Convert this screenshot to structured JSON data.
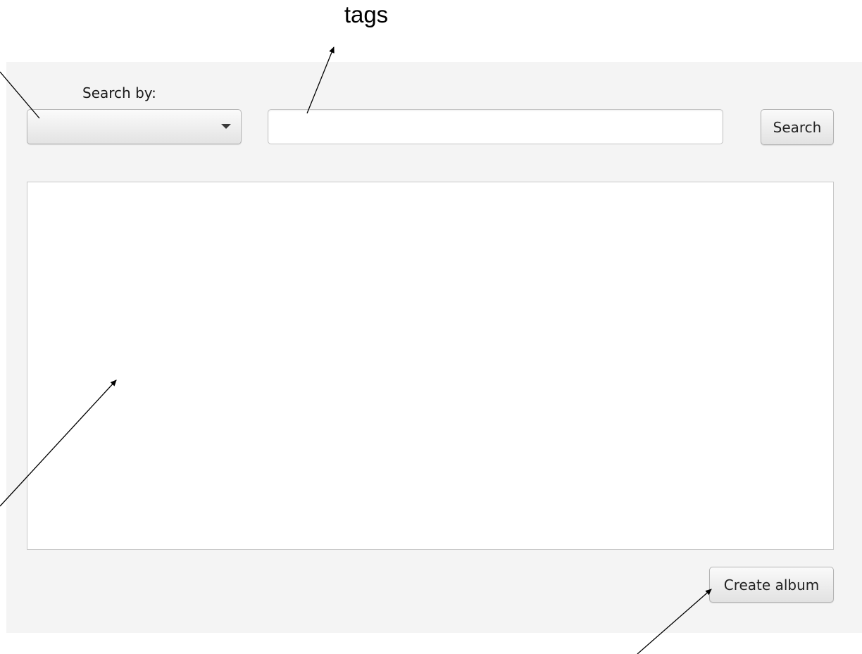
{
  "annotation": {
    "tags_label": "tags"
  },
  "search_panel": {
    "search_by_label": "Search by:",
    "search_by_selected": "",
    "search_input_value": "",
    "search_button_label": "Search"
  },
  "results": {
    "items": []
  },
  "footer": {
    "create_album_label": "Create album"
  },
  "icons": {
    "combo_arrow": "chevron-down-icon"
  }
}
